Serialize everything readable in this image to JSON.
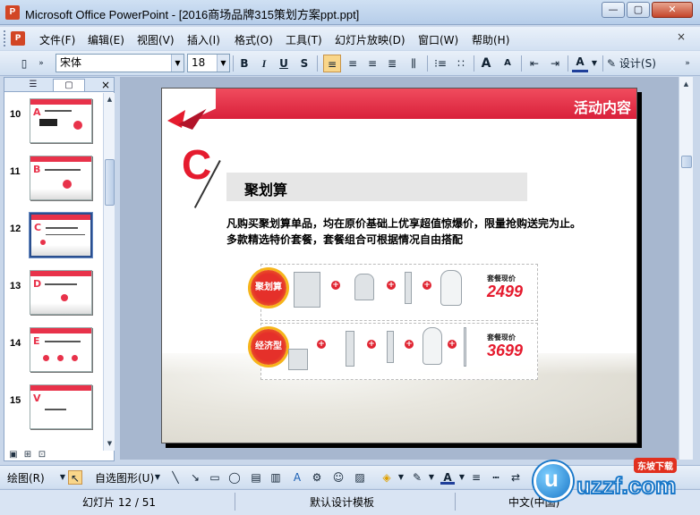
{
  "window": {
    "title": "Microsoft Office PowerPoint - [2016商场品牌315策划方案ppt.ppt]",
    "min": "—",
    "max": "▢",
    "close": "✕"
  },
  "menu": {
    "items": [
      "文件(F)",
      "编辑(E)",
      "视图(V)",
      "插入(I)",
      "格式(O)",
      "工具(T)",
      "幻灯片放映(D)",
      "窗口(W)",
      "帮助(H)"
    ],
    "close": "×"
  },
  "toolbar": {
    "font": "宋体",
    "size": "18",
    "bold": "B",
    "italic": "I",
    "underline": "U",
    "shadow": "S",
    "font_color": "A",
    "grow": "A",
    "shrink": "A",
    "design": "设计(S)"
  },
  "left_pane": {
    "slides": [
      {
        "num": "10"
      },
      {
        "num": "11"
      },
      {
        "num": "12"
      },
      {
        "num": "13"
      },
      {
        "num": "14"
      },
      {
        "num": "15"
      }
    ],
    "close": "×"
  },
  "slide": {
    "title": "活动内容",
    "letter": "C",
    "heading": "聚划算",
    "body1": "凡购买聚划算单品，均在原价基础上优享超值惊爆价，限量抢购送完为止。",
    "body2": "多款精选特价套餐，套餐组合可根据情况自由搭配",
    "combos": [
      {
        "badge": "聚划算",
        "price_label": "套餐现价",
        "price": "2499"
      },
      {
        "badge": "经济型",
        "price_label": "套餐现价",
        "price": "3699"
      }
    ]
  },
  "drawbar": {
    "draw": "绘图(R)",
    "autoshape": "自选图形(U)"
  },
  "status": {
    "slide": "幻灯片 12 / 51",
    "template": "默认设计模板",
    "lang": "中文(中国)"
  },
  "watermark": {
    "text": "uzzf.com",
    "tag": "东坡下载"
  },
  "colors": {
    "accent_red": "#e51b2e",
    "office_blue": "#c9d7ea"
  }
}
